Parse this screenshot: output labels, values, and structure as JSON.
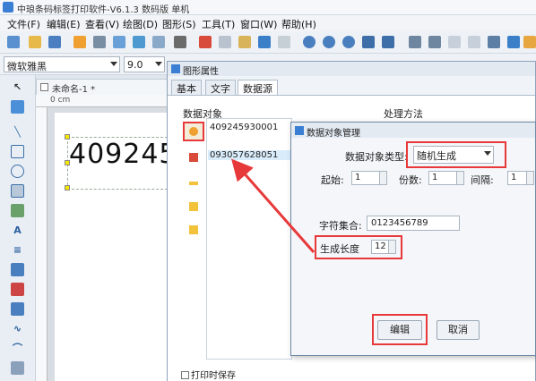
{
  "app": {
    "title": "中琅条码标签打印软件-V6.1.3 数码版 单机"
  },
  "menu": [
    {
      "label": "文件(F)"
    },
    {
      "label": "编辑(E)"
    },
    {
      "label": "查看(V)"
    },
    {
      "label": "绘图(D)"
    },
    {
      "label": "图形(S)"
    },
    {
      "label": "工具(T)"
    },
    {
      "label": "窗口(W)"
    },
    {
      "label": "帮助(H)"
    }
  ],
  "fontbar": {
    "font_name": "微软雅黑",
    "font_size": "9.0"
  },
  "document": {
    "tab_label": "未命名-1 *",
    "ruler_unit": "0 cm",
    "barcode_text": "409245"
  },
  "props_dialog": {
    "title": "图形属性",
    "tabs": [
      {
        "label": "基本"
      },
      {
        "label": "文字"
      },
      {
        "label": "数据源"
      }
    ],
    "data_object_label": "数据对象",
    "process_label": "处理方法",
    "items": [
      {
        "value": "409245930001"
      },
      {
        "value": "093057628051"
      }
    ],
    "print_save_label": "打印时保存"
  },
  "mgmt_dialog": {
    "title": "数据对象管理",
    "type_label": "数据对象类型:",
    "type_value": "随机生成",
    "start_label": "起始:",
    "start_value": "1",
    "copies_label": "份数:",
    "copies_value": "1",
    "interval_label": "间隔:",
    "interval_value": "1",
    "charset_label": "字符集合:",
    "charset_value": "0123456789",
    "length_label": "生成长度",
    "length_value": "12",
    "edit_button": "编辑",
    "cancel_button": "取消"
  },
  "colors": {
    "highlight": "#e8393a",
    "accent": "#3b7fd4"
  }
}
